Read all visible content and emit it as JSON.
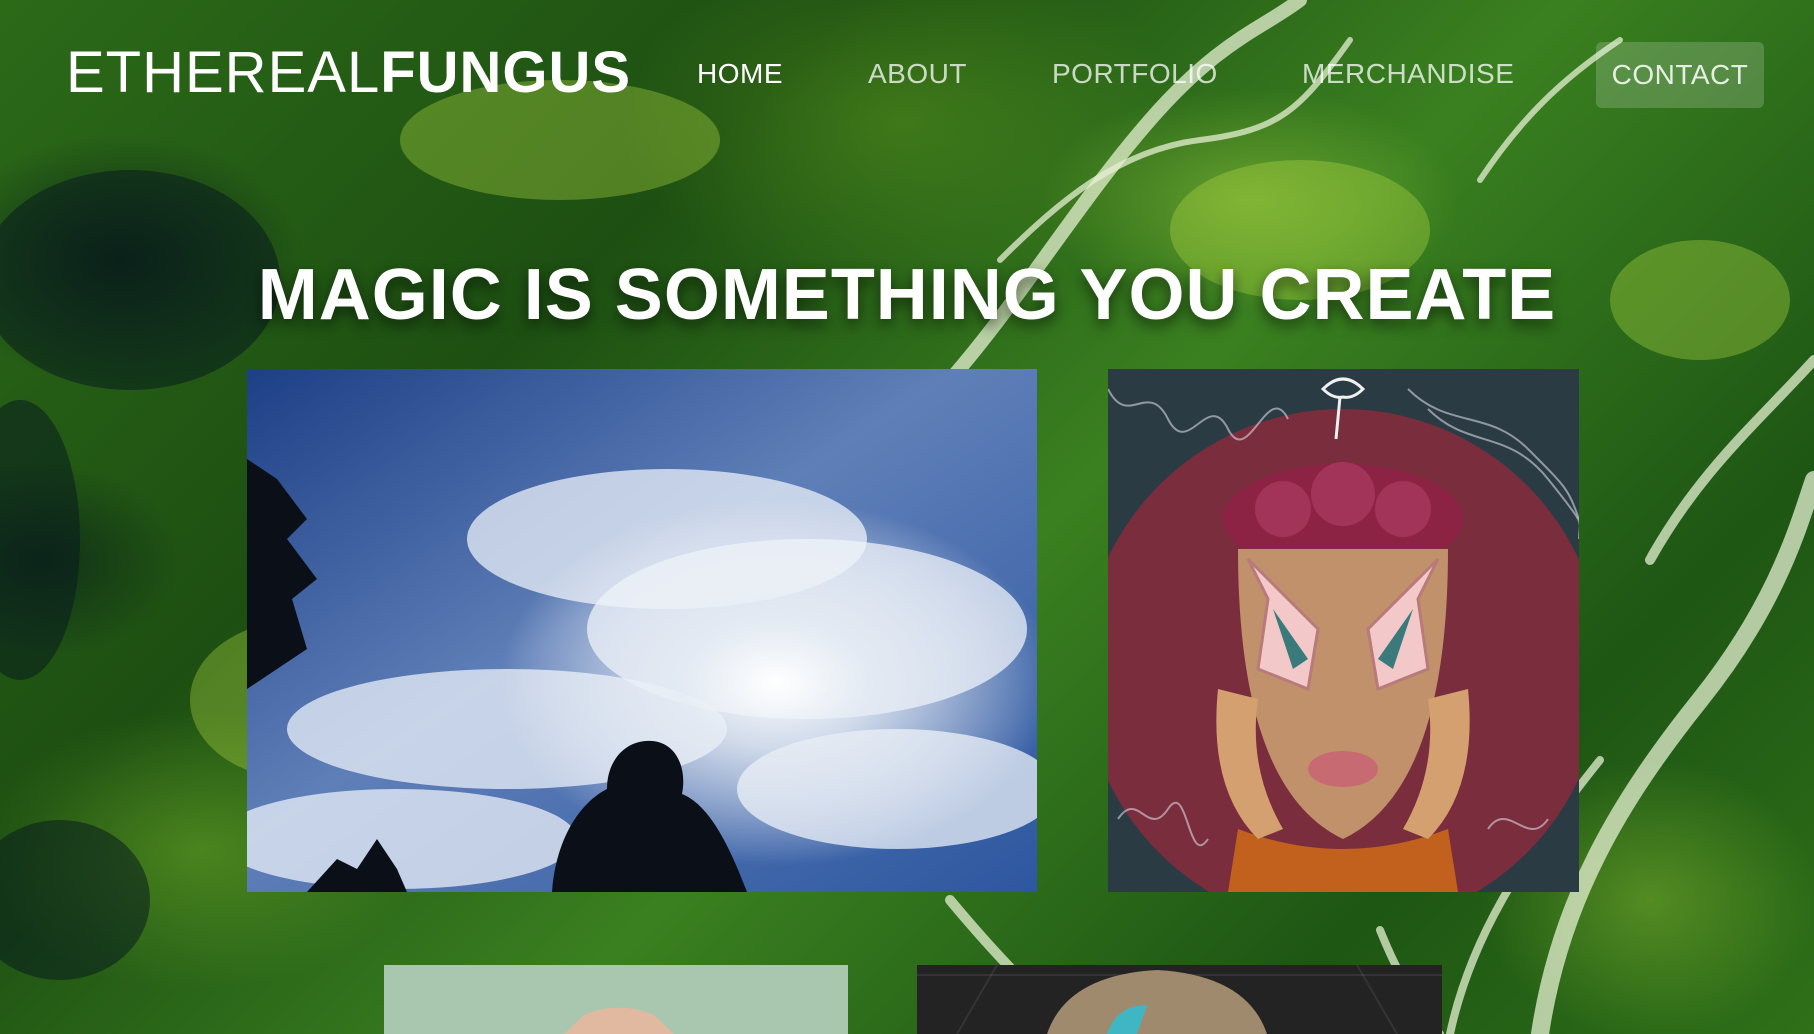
{
  "site": {
    "logo_light": "ETHEREAL",
    "logo_bold": "FUNGUS"
  },
  "nav": {
    "items": [
      {
        "label": "HOME",
        "active": true
      },
      {
        "label": "ABOUT",
        "active": false
      },
      {
        "label": "PORTFOLIO",
        "active": false
      },
      {
        "label": "MERCHANDISE",
        "active": false
      }
    ],
    "contact": "CONTACT"
  },
  "hero": {
    "headline": "MAGIC IS SOMETHING YOU CREATE"
  },
  "gallery": {
    "images": [
      {
        "subject": "girl silhouette under cloudy blue sky"
      },
      {
        "subject": "illustrated portrait with mushroom and flame eyes"
      },
      {
        "subject": "partial artwork, pale green background"
      },
      {
        "subject": "partial artwork, dark background with figure"
      }
    ]
  },
  "colors": {
    "text": "#ffffff",
    "nav_muted": "#c9d6c4",
    "background_green": "#2c6a18"
  }
}
